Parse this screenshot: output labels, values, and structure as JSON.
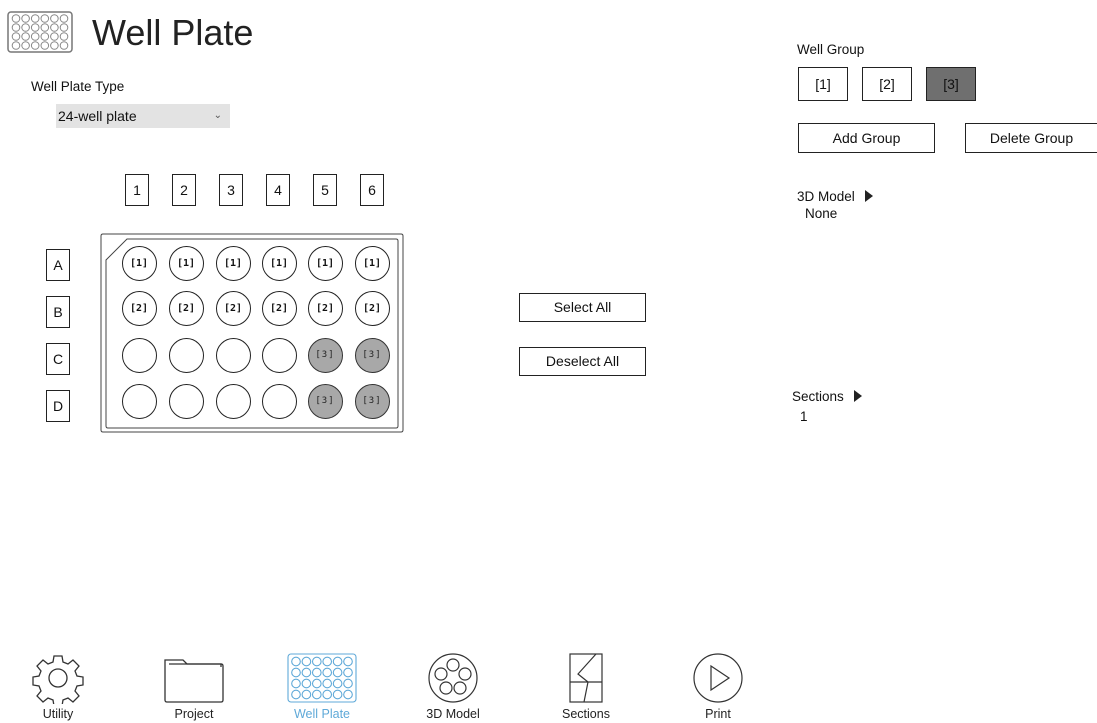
{
  "header": {
    "title": "Well Plate",
    "icon": "well-plate-icon"
  },
  "plate_type": {
    "label": "Well Plate Type",
    "selected": "24-well plate"
  },
  "columns": [
    "1",
    "2",
    "3",
    "4",
    "5",
    "6"
  ],
  "rows": [
    "A",
    "B",
    "C",
    "D"
  ],
  "wells": [
    [
      "[1]",
      "[1]",
      "[1]",
      "[1]",
      "[1]",
      "[1]"
    ],
    [
      "[2]",
      "[2]",
      "[2]",
      "[2]",
      "[2]",
      "[2]"
    ],
    [
      "",
      "",
      "",
      "",
      "[3]",
      "[3]"
    ],
    [
      "",
      "",
      "",
      "",
      "[3]",
      "[3]"
    ]
  ],
  "actions": {
    "select_all": "Select All",
    "deselect_all": "Deselect All"
  },
  "well_group": {
    "label": "Well Group",
    "groups": [
      "[1]",
      "[2]",
      "[3]"
    ],
    "active_group": "[3]",
    "add_label": "Add Group",
    "delete_label": "Delete Group",
    "active_color": "#6f6f6f"
  },
  "model": {
    "label": "3D Model",
    "value": "None"
  },
  "sections": {
    "label": "Sections",
    "value": "1"
  },
  "nav": [
    {
      "label": "Utility",
      "icon": "gear-icon",
      "active": false
    },
    {
      "label": "Project",
      "icon": "folder-icon",
      "active": false
    },
    {
      "label": "Well Plate",
      "icon": "well-plate-icon",
      "active": true
    },
    {
      "label": "3D Model",
      "icon": "3d-model-icon",
      "active": false
    },
    {
      "label": "Sections",
      "icon": "sections-icon",
      "active": false
    },
    {
      "label": "Print",
      "icon": "play-icon",
      "active": false
    }
  ],
  "colors": {
    "accent": "#5fa9d8",
    "selected_well": "#a8a8a8"
  }
}
